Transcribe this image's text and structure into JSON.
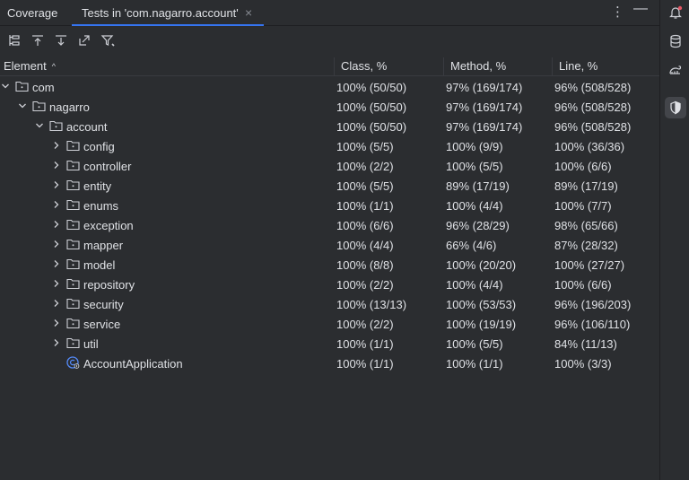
{
  "tabs": {
    "panel_title": "Coverage",
    "active_tab": "Tests in 'com.nagarro.account'",
    "close_glyph": "×",
    "menu_glyph": "⋮",
    "minimize_glyph": "—"
  },
  "toolbar": {
    "icons": [
      "flatten-packages-icon",
      "import-icon",
      "export-icon",
      "navigate-icon",
      "filter-icon"
    ]
  },
  "columns": {
    "element": "Element",
    "class": "Class, %",
    "method": "Method, %",
    "line": "Line, %",
    "sort_glyph": "^"
  },
  "rows": [
    {
      "name": "com",
      "class": "100% (50/50)",
      "method": "97% (169/174)",
      "line": "96% (508/528)",
      "depth": 0,
      "kind": "package",
      "expanded": true
    },
    {
      "name": "nagarro",
      "class": "100% (50/50)",
      "method": "97% (169/174)",
      "line": "96% (508/528)",
      "depth": 1,
      "kind": "package",
      "expanded": true
    },
    {
      "name": "account",
      "class": "100% (50/50)",
      "method": "97% (169/174)",
      "line": "96% (508/528)",
      "depth": 2,
      "kind": "package",
      "expanded": true
    },
    {
      "name": "config",
      "class": "100% (5/5)",
      "method": "100% (9/9)",
      "line": "100% (36/36)",
      "depth": 3,
      "kind": "package",
      "expanded": false
    },
    {
      "name": "controller",
      "class": "100% (2/2)",
      "method": "100% (5/5)",
      "line": "100% (6/6)",
      "depth": 3,
      "kind": "package",
      "expanded": false
    },
    {
      "name": "entity",
      "class": "100% (5/5)",
      "method": "89% (17/19)",
      "line": "89% (17/19)",
      "depth": 3,
      "kind": "package",
      "expanded": false
    },
    {
      "name": "enums",
      "class": "100% (1/1)",
      "method": "100% (4/4)",
      "line": "100% (7/7)",
      "depth": 3,
      "kind": "package",
      "expanded": false
    },
    {
      "name": "exception",
      "class": "100% (6/6)",
      "method": "96% (28/29)",
      "line": "98% (65/66)",
      "depth": 3,
      "kind": "package",
      "expanded": false
    },
    {
      "name": "mapper",
      "class": "100% (4/4)",
      "method": "66% (4/6)",
      "line": "87% (28/32)",
      "depth": 3,
      "kind": "package",
      "expanded": false
    },
    {
      "name": "model",
      "class": "100% (8/8)",
      "method": "100% (20/20)",
      "line": "100% (27/27)",
      "depth": 3,
      "kind": "package",
      "expanded": false
    },
    {
      "name": "repository",
      "class": "100% (2/2)",
      "method": "100% (4/4)",
      "line": "100% (6/6)",
      "depth": 3,
      "kind": "package",
      "expanded": false
    },
    {
      "name": "security",
      "class": "100% (13/13)",
      "method": "100% (53/53)",
      "line": "96% (196/203)",
      "depth": 3,
      "kind": "package",
      "expanded": false
    },
    {
      "name": "service",
      "class": "100% (2/2)",
      "method": "100% (19/19)",
      "line": "96% (106/110)",
      "depth": 3,
      "kind": "package",
      "expanded": false
    },
    {
      "name": "util",
      "class": "100% (1/1)",
      "method": "100% (5/5)",
      "line": "84% (11/13)",
      "depth": 3,
      "kind": "package",
      "expanded": false
    },
    {
      "name": "AccountApplication",
      "class": "100% (1/1)",
      "method": "100% (1/1)",
      "line": "100% (3/3)",
      "depth": 3,
      "kind": "class",
      "expanded": null
    }
  ],
  "right_strip": {
    "icons": [
      "notifications-icon",
      "database-icon",
      "gradle-icon",
      "coverage-shield-icon"
    ]
  },
  "colors": {
    "background": "#2b2d30",
    "text": "#dfe1e5",
    "accent": "#3574f0",
    "notification_dot": "#e55765"
  }
}
